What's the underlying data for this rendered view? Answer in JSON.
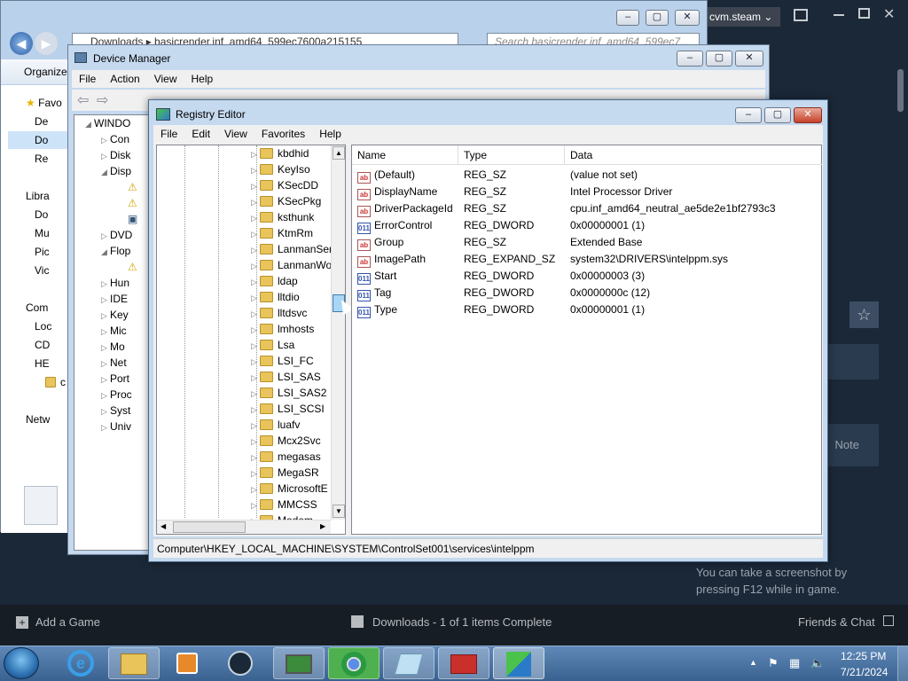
{
  "steam": {
    "account": "cvm.steam",
    "note": "Note",
    "tip": "You can take a screenshot by pressing F12 while in game.",
    "add_game": "Add a Game",
    "downloads": "Downloads - 1 of 1 items Complete",
    "friends": "Friends & Chat"
  },
  "explorer": {
    "address": "Downloads ▸ basicrender.inf_amd64_599ec7600a215155",
    "search_placeholder": "Search basicrender.inf_amd64_599ec7...",
    "organize": "Organize",
    "sidebar": [
      "Favo",
      "De",
      "Do",
      "Re",
      "Libra",
      "Do",
      "Mu",
      "Pic",
      "Vic",
      "Com",
      "Loc",
      "CD",
      "HE",
      "c",
      "Netw"
    ]
  },
  "devmgr": {
    "title": "Device Manager",
    "menu": [
      "File",
      "Action",
      "View",
      "Help"
    ],
    "root": "WINDO",
    "items": [
      "Con",
      "Disk",
      "Disp",
      "",
      "",
      "",
      "DVD",
      "Flop",
      "",
      "Hun",
      "IDE",
      "Key",
      "Mic",
      "Mo",
      "Net",
      "Port",
      "Proc",
      "Syst",
      "Univ"
    ]
  },
  "regedit": {
    "title": "Registry Editor",
    "menu": [
      "File",
      "Edit",
      "View",
      "Favorites",
      "Help"
    ],
    "tree": [
      "kbdhid",
      "KeyIso",
      "KSecDD",
      "KSecPkg",
      "ksthunk",
      "KtmRm",
      "LanmanSer",
      "LanmanWo",
      "ldap",
      "lltdio",
      "lltdsvc",
      "lmhosts",
      "Lsa",
      "LSI_FC",
      "LSI_SAS",
      "LSI_SAS2",
      "LSI_SCSI",
      "luafv",
      "Mcx2Svc",
      "megasas",
      "MegaSR",
      "MicrosoftE",
      "MMCSS",
      "Modem"
    ],
    "columns": {
      "name": "Name",
      "type": "Type",
      "data": "Data"
    },
    "values": [
      {
        "icon": "ab",
        "name": "(Default)",
        "type": "REG_SZ",
        "data": "(value not set)"
      },
      {
        "icon": "ab",
        "name": "DisplayName",
        "type": "REG_SZ",
        "data": "Intel Processor Driver"
      },
      {
        "icon": "ab",
        "name": "DriverPackageId",
        "type": "REG_SZ",
        "data": "cpu.inf_amd64_neutral_ae5de2e1bf2793c3"
      },
      {
        "icon": "bin",
        "name": "ErrorControl",
        "type": "REG_DWORD",
        "data": "0x00000001 (1)"
      },
      {
        "icon": "ab",
        "name": "Group",
        "type": "REG_SZ",
        "data": "Extended Base"
      },
      {
        "icon": "ab",
        "name": "ImagePath",
        "type": "REG_EXPAND_SZ",
        "data": "system32\\DRIVERS\\intelppm.sys"
      },
      {
        "icon": "bin",
        "name": "Start",
        "type": "REG_DWORD",
        "data": "0x00000003 (3)"
      },
      {
        "icon": "bin",
        "name": "Tag",
        "type": "REG_DWORD",
        "data": "0x0000000c (12)"
      },
      {
        "icon": "bin",
        "name": "Type",
        "type": "REG_DWORD",
        "data": "0x00000001 (1)"
      }
    ],
    "status": "Computer\\HKEY_LOCAL_MACHINE\\SYSTEM\\ControlSet001\\services\\intelppm"
  },
  "taskbar": {
    "time": "12:25 PM",
    "date": "7/21/2024"
  }
}
